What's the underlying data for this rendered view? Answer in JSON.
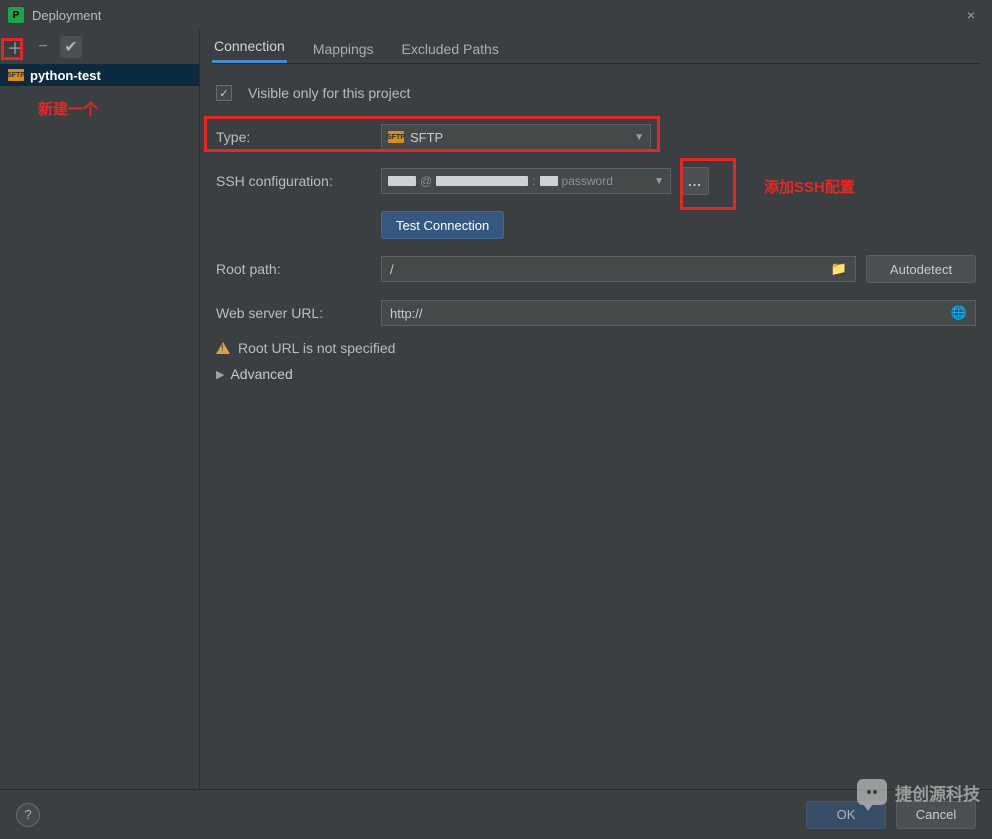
{
  "window": {
    "title": "Deployment"
  },
  "sidebar": {
    "items": [
      {
        "label": "python-test",
        "icon_text": "SFTP"
      }
    ]
  },
  "tabs": [
    {
      "label": "Connection",
      "active": true
    },
    {
      "label": "Mappings",
      "active": false
    },
    {
      "label": "Excluded Paths",
      "active": false
    }
  ],
  "form": {
    "visible_only_label": "Visible only for this project",
    "visible_only_checked": true,
    "type_label": "Type:",
    "type_value": "SFTP",
    "type_icon_text": "SFTP",
    "ssh_config_label": "SSH configuration:",
    "ssh_config_value_suffix": "password",
    "test_connection_label": "Test Connection",
    "root_path_label": "Root path:",
    "root_path_value": "/",
    "autodetect_label": "Autodetect",
    "web_url_label": "Web server URL:",
    "web_url_value": "http://",
    "warn_text": "Root URL is not specified",
    "advanced_label": "Advanced",
    "browse_button_label": "..."
  },
  "annotations": {
    "new_one": "新建一个",
    "add_ssh": "添加SSH配置"
  },
  "buttons": {
    "ok": "OK",
    "cancel": "Cancel"
  },
  "watermark": "捷创源科技"
}
